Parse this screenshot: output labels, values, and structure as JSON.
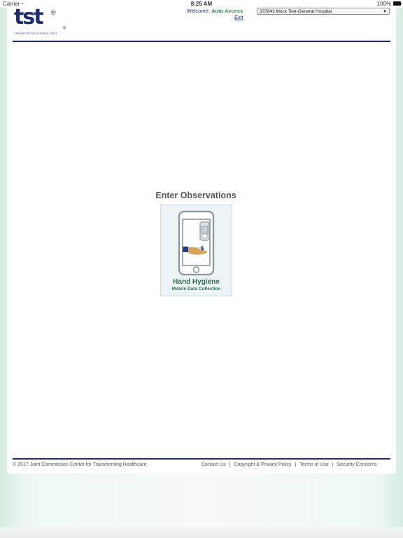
{
  "statusbar": {
    "carrier": "Carrier",
    "time": "8:25 AM",
    "battery": "100%"
  },
  "header": {
    "logo_text": "tst",
    "logo_tagline": "TARGETED SOLUTIONS TOOL",
    "welcome_prefix": "Welcome,",
    "user_name": "Auto Access",
    "exit_label": "Exit",
    "organization_selected": "337843 Mock Test-General Hospital"
  },
  "main": {
    "section_title": "Enter Observations",
    "card": {
      "title": "Hand Hygiene",
      "subtitle": "Mobile Data Collection"
    }
  },
  "footer": {
    "copyright": "© 2017 Joint Commission Center for Transforming Healthcare",
    "links": [
      "Contact Us",
      "Copyright & Privacy Policy",
      "Terms of Use",
      "Security Concerns"
    ],
    "separator": "|"
  },
  "colors": {
    "brand_navy": "#1d2e6b",
    "brand_green": "#2f8a55",
    "card_bg": "#edf4f8"
  }
}
